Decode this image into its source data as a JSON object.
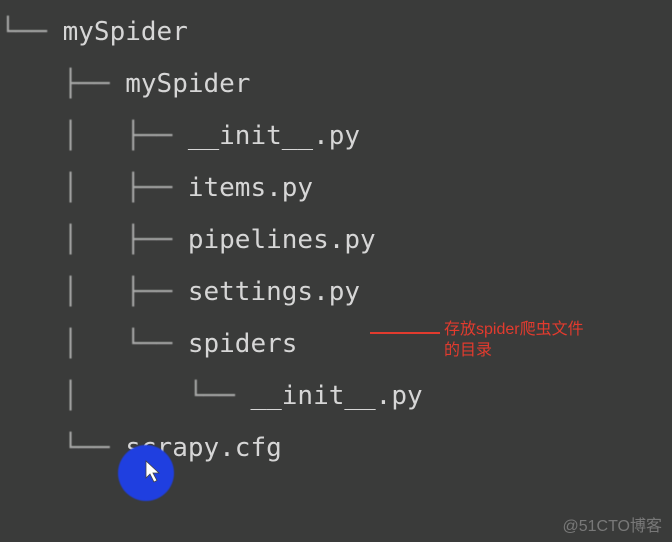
{
  "tree": {
    "rows": [
      {
        "connector": "└── ",
        "name": "mySpider"
      },
      {
        "connector": "    ├── ",
        "name": "mySpider"
      },
      {
        "connector": "    │   ├── ",
        "name": "__init__.py"
      },
      {
        "connector": "    │   ├── ",
        "name": "items.py"
      },
      {
        "connector": "    │   ├── ",
        "name": "pipelines.py"
      },
      {
        "connector": "    │   ├── ",
        "name": "settings.py"
      },
      {
        "connector": "    │   └── ",
        "name": "spiders"
      },
      {
        "connector": "    │       └── ",
        "name": "__init__.py"
      },
      {
        "connector": "    └── ",
        "name": "scrapy.cfg"
      }
    ]
  },
  "annotation": {
    "line1": "存放spider爬虫文件",
    "line2": "的目录"
  },
  "watermark": "@51CTO博客"
}
